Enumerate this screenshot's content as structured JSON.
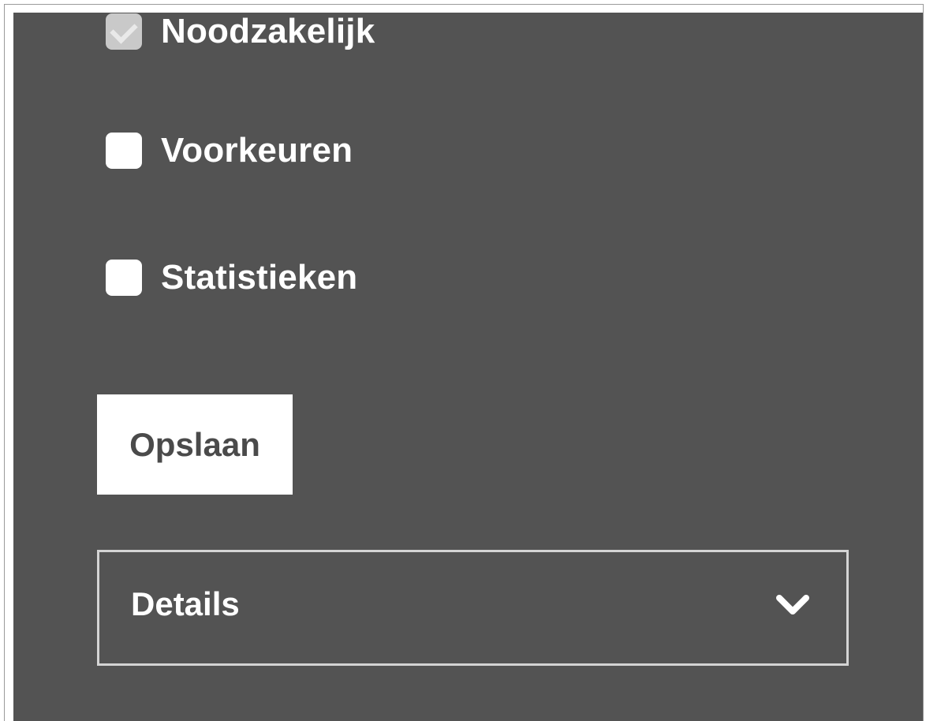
{
  "consent": {
    "options": [
      {
        "label": "Noodzakelijk",
        "checked": true,
        "disabled": true
      },
      {
        "label": "Voorkeuren",
        "checked": false,
        "disabled": false
      },
      {
        "label": "Statistieken",
        "checked": false,
        "disabled": false
      }
    ],
    "save_label": "Opslaan",
    "details_label": "Details",
    "details_icon": "chevron-down-icon"
  },
  "colors": {
    "panel_background": "#535353",
    "checkbox_fill": "#ffffff",
    "checkbox_disabled_fill": "#c9c9c9",
    "button_text": "#4a4a4a",
    "details_border": "#d4d4d4"
  }
}
